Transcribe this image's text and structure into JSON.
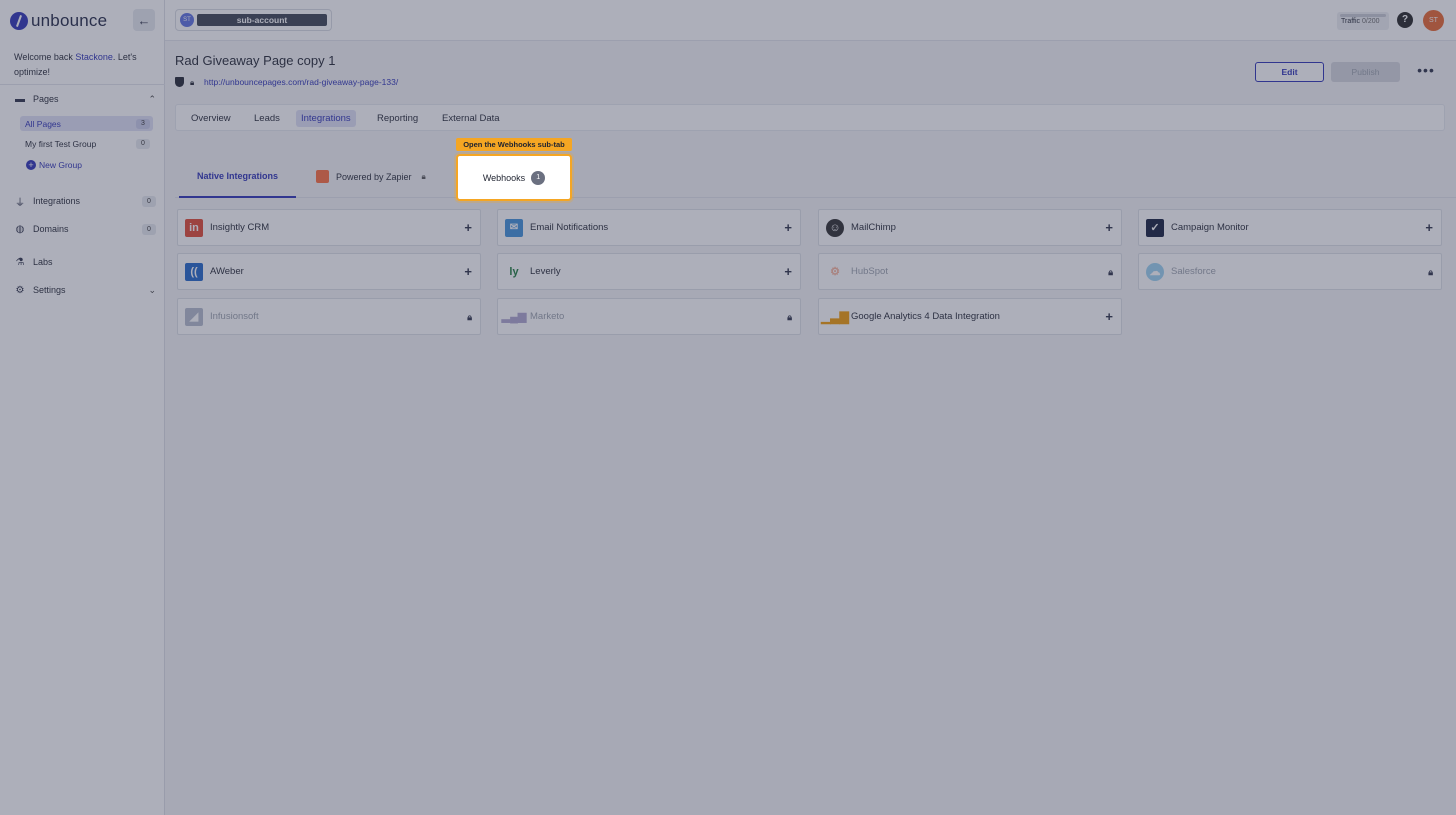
{
  "app": {
    "logo_text": "unbounce",
    "collapse_icon": "←"
  },
  "welcome": {
    "prefix": "Welcome back ",
    "user": "Stackone",
    "suffix": ". Let's optimize!"
  },
  "sidebar": {
    "pages_label": "Pages",
    "all_pages": {
      "label": "All Pages",
      "count": "3"
    },
    "test_group": {
      "label": "My first Test Group",
      "count": "0"
    },
    "new_group_label": "New Group",
    "integrations": {
      "label": "Integrations",
      "count": "0"
    },
    "domains": {
      "label": "Domains",
      "count": "0"
    },
    "labs_label": "Labs",
    "settings_label": "Settings"
  },
  "topbar": {
    "account_initials": "ST",
    "account_name": "sub-account",
    "traffic_label": "Traffic",
    "traffic_value": "0/200",
    "help_label": "?",
    "user_initials": "ST"
  },
  "page": {
    "title": "Rad Giveaway Page copy 1",
    "url": "http://unbouncepages.com/rad-giveaway-page-133/",
    "edit_label": "Edit",
    "publish_label": "Publish",
    "more_label": "•••"
  },
  "main_tabs": [
    "Overview",
    "Leads",
    "Integrations",
    "Reporting",
    "External Data"
  ],
  "sub_tabs": {
    "native": "Native Integrations",
    "zapier": "Powered by Zapier",
    "webhooks": "Webhooks",
    "webhooks_count": "1",
    "tooltip": "Open the Webhooks sub-tab"
  },
  "integrations": [
    {
      "name": "Insightly CRM",
      "icon": "insightly-icon",
      "locked": false
    },
    {
      "name": "Email Notifications",
      "icon": "envelope-icon",
      "locked": false
    },
    {
      "name": "MailChimp",
      "icon": "mailchimp-icon",
      "locked": false
    },
    {
      "name": "Campaign Monitor",
      "icon": "campaign-monitor-icon",
      "locked": false
    },
    {
      "name": "AWeber",
      "icon": "aweber-icon",
      "locked": false
    },
    {
      "name": "Leverly",
      "icon": "leverly-icon",
      "locked": false
    },
    {
      "name": "HubSpot",
      "icon": "hubspot-icon",
      "locked": true
    },
    {
      "name": "Salesforce",
      "icon": "salesforce-icon",
      "locked": true
    },
    {
      "name": "Infusionsoft",
      "icon": "infusionsoft-icon",
      "locked": true
    },
    {
      "name": "Marketo",
      "icon": "marketo-icon",
      "locked": true
    },
    {
      "name": "Google Analytics 4 Data Integration",
      "icon": "google-analytics-icon",
      "locked": false
    }
  ],
  "colors": {
    "brand": "#2a2fb5",
    "highlight": "#f5a623",
    "avatar": "#e8642c"
  }
}
